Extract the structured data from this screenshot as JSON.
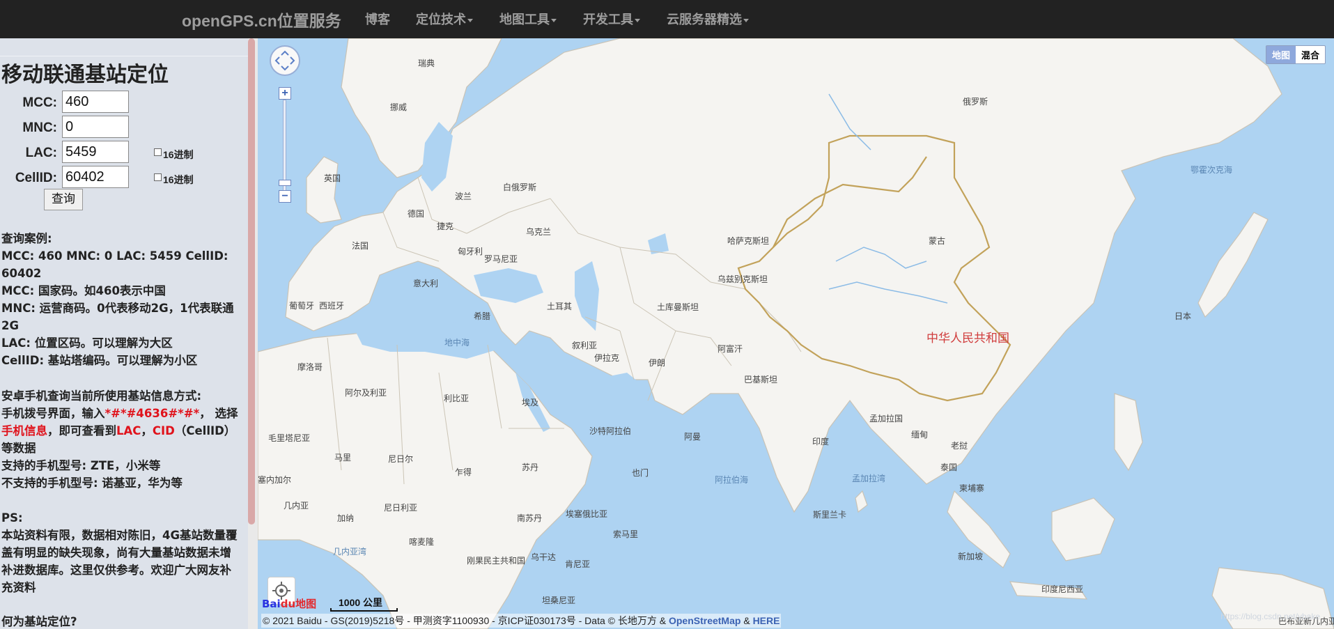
{
  "navbar": {
    "brand": "openGPS.cn位置服务",
    "items": [
      {
        "label": "博客",
        "dropdown": false
      },
      {
        "label": "定位技术",
        "dropdown": true
      },
      {
        "label": "地图工具",
        "dropdown": true
      },
      {
        "label": "开发工具",
        "dropdown": true
      },
      {
        "label": "云服务器精选",
        "dropdown": true
      }
    ]
  },
  "form": {
    "title": "移动联通基站定位",
    "mcc": {
      "label": "MCC:",
      "value": "460"
    },
    "mnc": {
      "label": "MNC:",
      "value": "0"
    },
    "lac": {
      "label": "LAC:",
      "value": "5459",
      "hex_label": "16进制",
      "hex_checked": false
    },
    "cellid": {
      "label": "CellID:",
      "value": "60402",
      "hex_label": "16进制",
      "hex_checked": false
    },
    "query_button": "查询"
  },
  "info": {
    "example_title": "查询案例:",
    "example_line": "MCC: 460 MNC: 0 LAC: 5459 CellID: 60402",
    "mcc_desc": "MCC: 国家码。如460表示中国",
    "mnc_desc": "MNC: 运营商码。0代表移动2G，1代表联通2G",
    "lac_desc": "LAC: 位置区码。可以理解为大区",
    "cellid_desc": "CellID: 基站塔编码。可以理解为小区",
    "android_title": "安卓手机查询当前所使用基站信息方式:",
    "android_p1": "手机拨号界面，输入",
    "android_code": "*#*#4636#*#*",
    "android_p2": "， 选择",
    "android_phoneinfo": "手机信息",
    "android_p3": "，即可查看到",
    "android_lac": "LAC",
    "android_sep": "，",
    "android_cid": "CID",
    "android_p4": "（CellID）等数据",
    "supported": "支持的手机型号: ZTE，小米等",
    "unsupported": "不支持的手机型号: 诺基亚，华为等",
    "ps_title": "PS:",
    "ps_text": "本站资料有限，数据相对陈旧，4G基站数量覆盖有明显的缺失现象，尚有大量基站数据未增补进数据库。这里仅供参考。欢迎广大网友补充资料",
    "what_title": "何为基站定位?"
  },
  "map": {
    "type_buttons": [
      "地图",
      "混合"
    ],
    "active_type": "地图",
    "scale_label": "1000 公里",
    "logo_text_b": "Bai",
    "logo_text_du": "du",
    "logo_map": "地图",
    "copyright_prefix": "© 2021 Baidu - GS(2019)5218号 - 甲测资字1100930 - 京ICP证030173号 - Data © 长地万方 & ",
    "copyright_osm": "OpenStreetMap",
    "copyright_amp": " & ",
    "copyright_here": "HERE",
    "watermark": "https://blog.csdn.net/ybake",
    "labels": {
      "sweden": "瑞典",
      "norway": "挪威",
      "russia": "俄罗斯",
      "okhotsk": "鄂霍次克海",
      "uk": "英国",
      "poland": "波兰",
      "belarus": "白俄罗斯",
      "germany": "德国",
      "czech": "捷克",
      "ukraine": "乌克兰",
      "france": "法国",
      "hungary": "匈牙利",
      "romania": "罗马尼亚",
      "kazakhstan": "哈萨克斯坦",
      "mongolia": "蒙古",
      "italy": "意大利",
      "uzbekistan": "乌兹别克斯坦",
      "portugal": "葡萄牙",
      "spain": "西班牙",
      "greece": "希腊",
      "turkey": "土耳其",
      "turkmenistan": "土库曼斯坦",
      "china": "中华人民共和国",
      "japan": "日本",
      "mediterranean": "地中海",
      "syria": "叙利亚",
      "iraq": "伊拉克",
      "iran": "伊朗",
      "afghanistan": "阿富汗",
      "morocco": "摩洛哥",
      "pakistan": "巴基斯坦",
      "algeria": "阿尔及利亚",
      "libya": "利比亚",
      "egypt": "埃及",
      "bangladesh": "孟加拉国",
      "saudi": "沙特阿拉伯",
      "oman": "阿曼",
      "india": "印度",
      "myanmar": "缅甸",
      "laos": "老挝",
      "mauritania": "毛里塔尼亚",
      "mali": "马里",
      "niger": "尼日尔",
      "chad": "乍得",
      "sudan": "苏丹",
      "thailand": "泰国",
      "yemen": "也门",
      "cambodia": "柬埔寨",
      "arabian_sea": "阿拉伯海",
      "bay_of_bengal": "孟加拉湾",
      "senegal": "塞内加尔",
      "guinea": "几内亚",
      "ghana": "加纳",
      "nigeria": "尼日利亚",
      "south_sudan": "南苏丹",
      "ethiopia": "埃塞俄比亚",
      "sri_lanka": "斯里兰卡",
      "cameroon": "喀麦隆",
      "somalia": "索马里",
      "singapore": "新加坡",
      "gulf_guinea": "几内亚湾",
      "drc": "刚果民主共和国",
      "uganda": "乌干达",
      "kenya": "肯尼亚",
      "indonesia": "印度尼西亚",
      "tanzania": "坦桑尼亚",
      "png": "巴布亚新几内亚"
    }
  }
}
